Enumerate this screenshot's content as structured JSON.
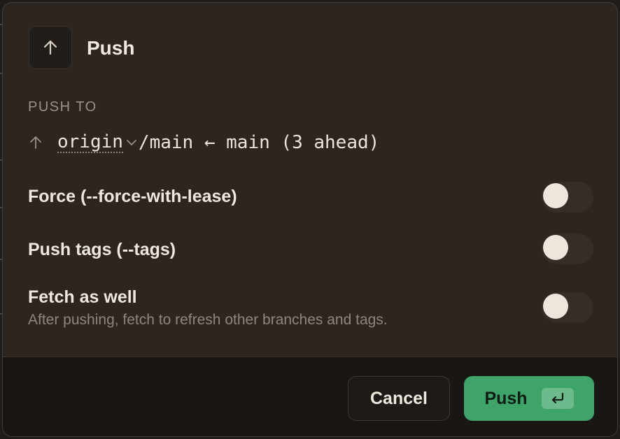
{
  "dialog": {
    "title": "Push",
    "title_icon": "arrow-up-icon"
  },
  "push_to": {
    "section_label": "PUSH TO",
    "remote": "origin",
    "branch_suffix": "/main ← main (3 ahead)"
  },
  "options": [
    {
      "title": "Force (--force-with-lease)",
      "enabled": false
    },
    {
      "title": "Push tags (--tags)",
      "enabled": false
    },
    {
      "title": "Fetch as well",
      "description": "After pushing, fetch to refresh other branches and tags.",
      "enabled": false
    }
  ],
  "footer": {
    "cancel_label": "Cancel",
    "push_label": "Push",
    "push_shortcut_icon": "enter-key-icon"
  },
  "colors": {
    "dialog_bg": "#2c2520",
    "footer_bg": "#1a1613",
    "accent_green": "#3fa46a",
    "text_primary": "#efe8de",
    "text_muted": "#8f877e"
  }
}
